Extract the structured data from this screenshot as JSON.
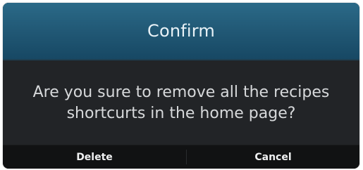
{
  "dialog": {
    "title": "Confirm",
    "message": "Are you sure to remove all the recipes shortcurts in the home page?",
    "buttons": {
      "delete": "Delete",
      "cancel": "Cancel"
    }
  },
  "colors": {
    "title_bar": "#225a77",
    "body": "#222427",
    "actions": "#111213",
    "text": "#d7d9db"
  }
}
